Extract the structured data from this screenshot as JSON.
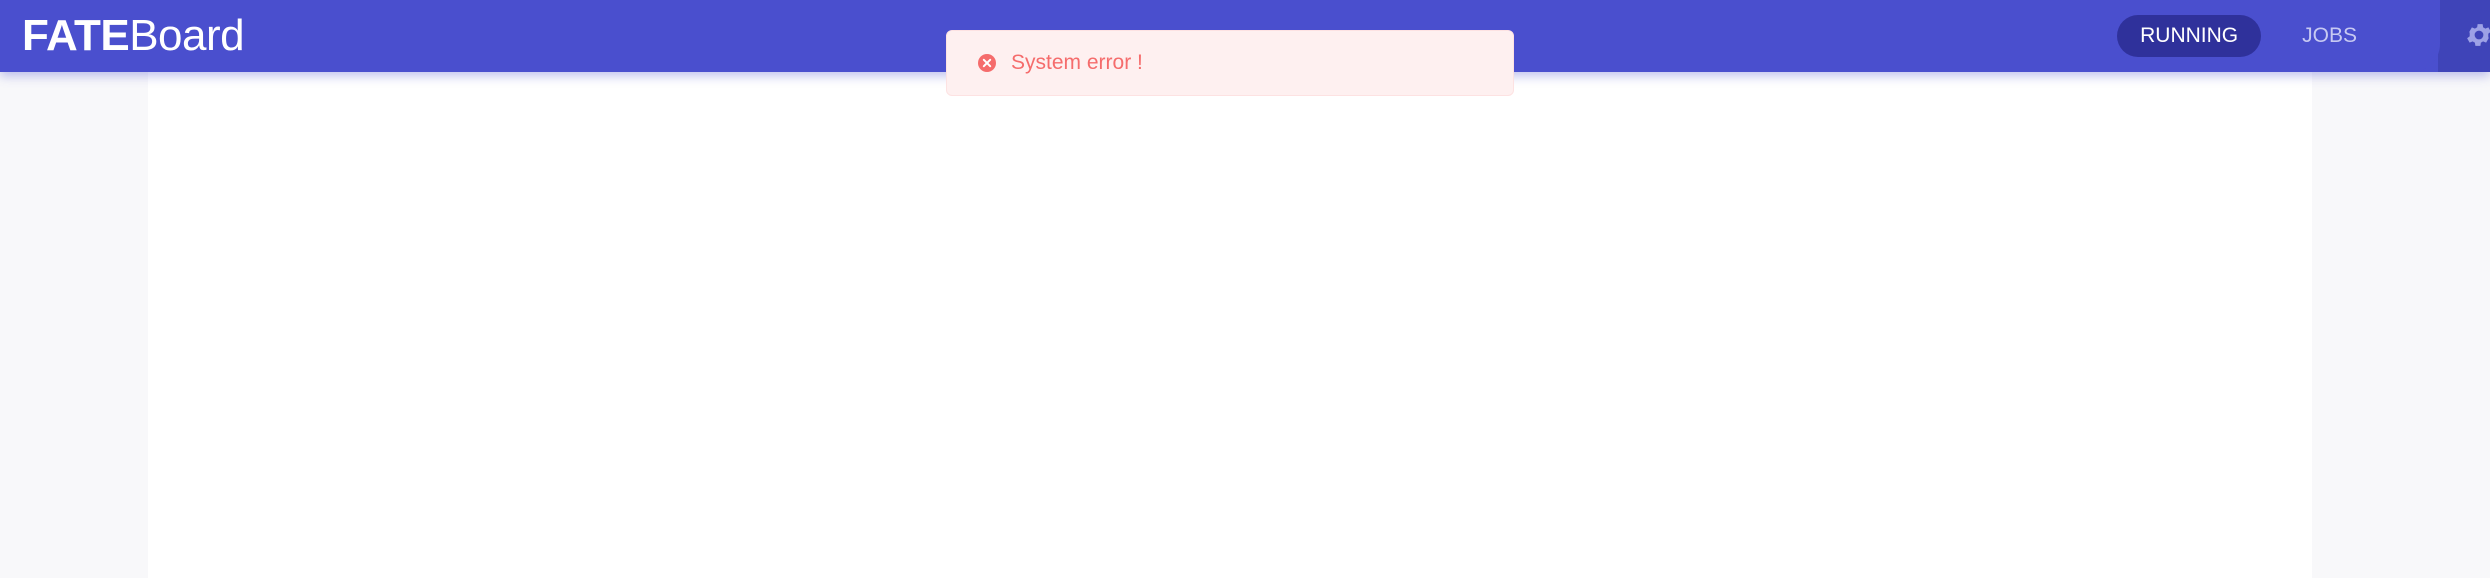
{
  "header": {
    "logo_bold": "FATE",
    "logo_light": "Board",
    "tabs": [
      {
        "label": "RUNNING",
        "active": true
      },
      {
        "label": "JOBS",
        "active": false
      }
    ],
    "settings_icon": "gear-icon"
  },
  "notification": {
    "type": "error",
    "icon": "error-circle-icon",
    "message": "System error !"
  },
  "colors": {
    "header": "#4a4fce",
    "active_tab": "#2f319b",
    "error_text": "#f56c6c",
    "error_bg": "#fef0f0"
  }
}
